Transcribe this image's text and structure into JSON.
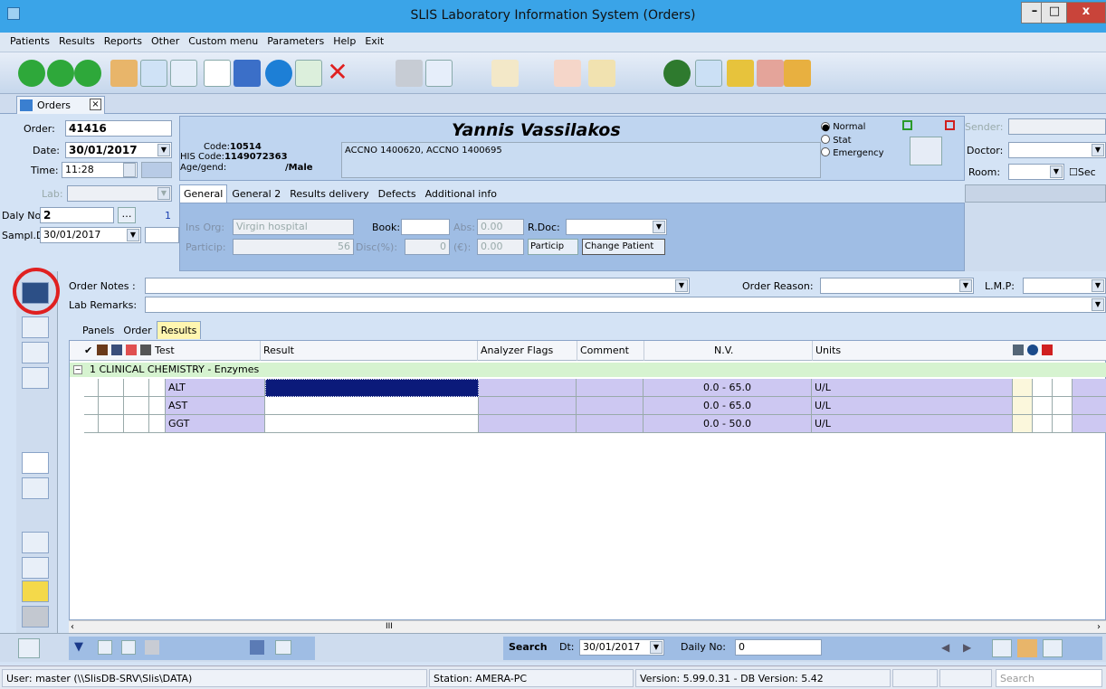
{
  "window": {
    "title": "SLIS Laboratory Information System (Orders)",
    "min": "–",
    "max": "□",
    "close": "x"
  },
  "menu": [
    "Patients",
    "Results",
    "Reports",
    "Other",
    "Custom menu",
    "Parameters",
    "Help",
    "Exit"
  ],
  "doc_tab": {
    "label": "Orders",
    "close": "×"
  },
  "order": {
    "order_label": "Order:",
    "order_value": "41416",
    "date_label": "Date:",
    "date_value": "30/01/2017",
    "time_label": "Time:",
    "time_value": "11:28",
    "lab_label": "Lab:",
    "daily_no_label": "Daly No:",
    "daily_no_value": "2",
    "daily_no_extra": "1",
    "sampl_label": "Sampl.D:",
    "sampl_value": "30/01/2017"
  },
  "patient": {
    "name": "Yannis Vassilakos",
    "code_label": "Code:",
    "code_value": "10514",
    "his_label": "HIS Code:",
    "his_value": "1149072363",
    "age_label": "Age/gend:",
    "gender": "/Male",
    "accno": "ACCNO 1400620, ACCNO 1400695"
  },
  "priority": {
    "normal": "Normal",
    "stat": "Stat",
    "emergency": "Emergency"
  },
  "right_fields": {
    "sender": "Sender:",
    "doctor": "Doctor:",
    "room": "Room:",
    "sec": "Sec"
  },
  "tabs": [
    "General",
    "General 2",
    "Results delivery",
    "Defects",
    "Additional info"
  ],
  "general": {
    "ins_org_label": "Ins Org:",
    "ins_org_value": "Virgin hospital",
    "book_label": "Book:",
    "abs_label": "Abs:",
    "abs_value": "0.00",
    "rdoc_label": "R.Doc:",
    "particip_label": "Particip:",
    "particip_value": "56",
    "disc_label": "Disc(%):",
    "disc_value": "0",
    "e_label": "(€):",
    "e_value": "0.00",
    "particip_btn": "Particip",
    "change_patient": "Change Patient"
  },
  "notes": {
    "order_notes": "Order Notes :",
    "lab_remarks": "Lab Remarks:",
    "order_reason": "Order Reason:",
    "lmp": "L.M.P:"
  },
  "subtabs": [
    "Panels",
    "Order",
    "Results"
  ],
  "grid": {
    "columns": [
      "Test",
      "Result",
      "Analyzer Flags",
      "Comment",
      "N.V.",
      "Units"
    ],
    "group": "1 CLINICAL CHEMISTRY - Enzymes",
    "rows": [
      {
        "test": "ALT",
        "result": "",
        "flags": "",
        "comment": "",
        "nv": "0.0 - 65.0",
        "units": "U/L"
      },
      {
        "test": "AST",
        "result": "",
        "flags": "",
        "comment": "",
        "nv": "0.0 - 65.0",
        "units": "U/L"
      },
      {
        "test": "GGT",
        "result": "",
        "flags": "",
        "comment": "",
        "nv": "0.0 - 50.0",
        "units": "U/L"
      }
    ]
  },
  "bottom": {
    "search_label": "Search",
    "dt_label": "Dt:",
    "dt_value": "30/01/2017",
    "daily_label": "Daily No:",
    "daily_value": "0"
  },
  "status": {
    "user": "User: master  (\\\\SlisDB-SRV\\Slis\\DATA)",
    "station": "Station: AMERA-PC",
    "version": "Version: 5.99.0.31  -  DB Version: 5.42",
    "search_placeholder": "Search"
  }
}
